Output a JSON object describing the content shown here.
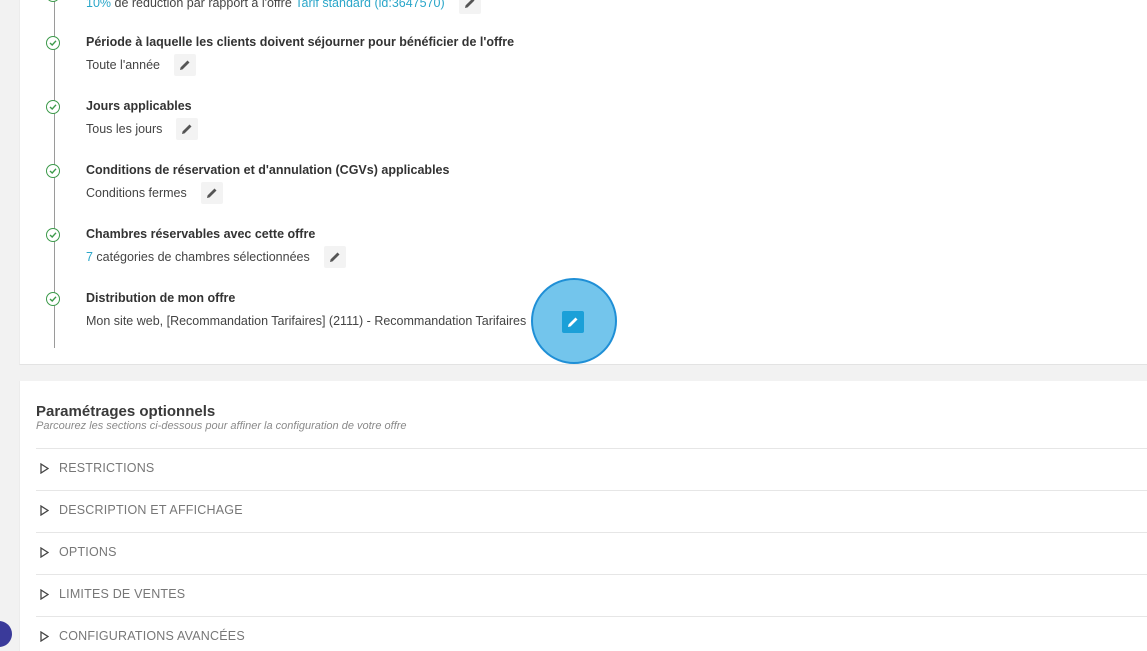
{
  "steps": [
    {
      "title": "",
      "value_prefix_link": "10%",
      "value_text": " de réduction par rapport à l'offre ",
      "value_suffix_link": "Tarif standard (id:3647570)"
    },
    {
      "title": "Période à laquelle les clients doivent séjourner pour bénéficier de l'offre",
      "value_text": "Toute l'année"
    },
    {
      "title": "Jours applicables",
      "value_text": "Tous les jours"
    },
    {
      "title": "Conditions de réservation et d'annulation (CGVs) applicables",
      "value_text": "Conditions fermes"
    },
    {
      "title": "Chambres réservables avec cette offre",
      "value_link": "7",
      "value_text": " catégories de chambres sélectionnées"
    },
    {
      "title": "Distribution de mon offre",
      "value_text": "Mon site web, [Recommandation Tarifaires] (2111) - Recommandation Tarifaires"
    }
  ],
  "optional": {
    "title": "Paramétrages optionnels",
    "subtitle": "Parcourez les sections ci-dessous pour affiner la configuration de votre offre",
    "sections": [
      "RESTRICTIONS",
      "DESCRIPTION ET AFFICHAGE",
      "OPTIONS",
      "LIMITES DE VENTES",
      "CONFIGURATIONS AVANCÉES"
    ]
  },
  "colors": {
    "accent": "#2aa6c9",
    "check": "#3c9a4a",
    "highlight": "#44b2e6"
  },
  "icons": {
    "check": "check-circle-icon",
    "edit": "pencil-icon",
    "expand": "triangle-right-icon"
  }
}
